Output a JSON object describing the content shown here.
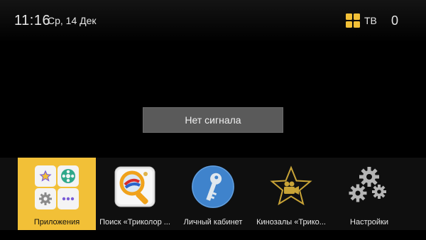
{
  "status_bar": {
    "time": "11:16",
    "date": "Ср, 14 Дек",
    "tv_label": "ТВ",
    "counter": "0",
    "accent_color": "#f2c037"
  },
  "message": {
    "text": "Нет сигнала"
  },
  "app_bar": {
    "selected_index": 0,
    "items": [
      {
        "label": "Приложения",
        "icon": "apps-grid-icon"
      },
      {
        "label": "Поиск «Триколор ...",
        "icon": "search-tricolor-icon"
      },
      {
        "label": "Личный кабинет",
        "icon": "key-icon"
      },
      {
        "label": "Кинозалы «Трико...",
        "icon": "star-camera-icon"
      },
      {
        "label": "Настройки",
        "icon": "gears-icon"
      }
    ]
  }
}
